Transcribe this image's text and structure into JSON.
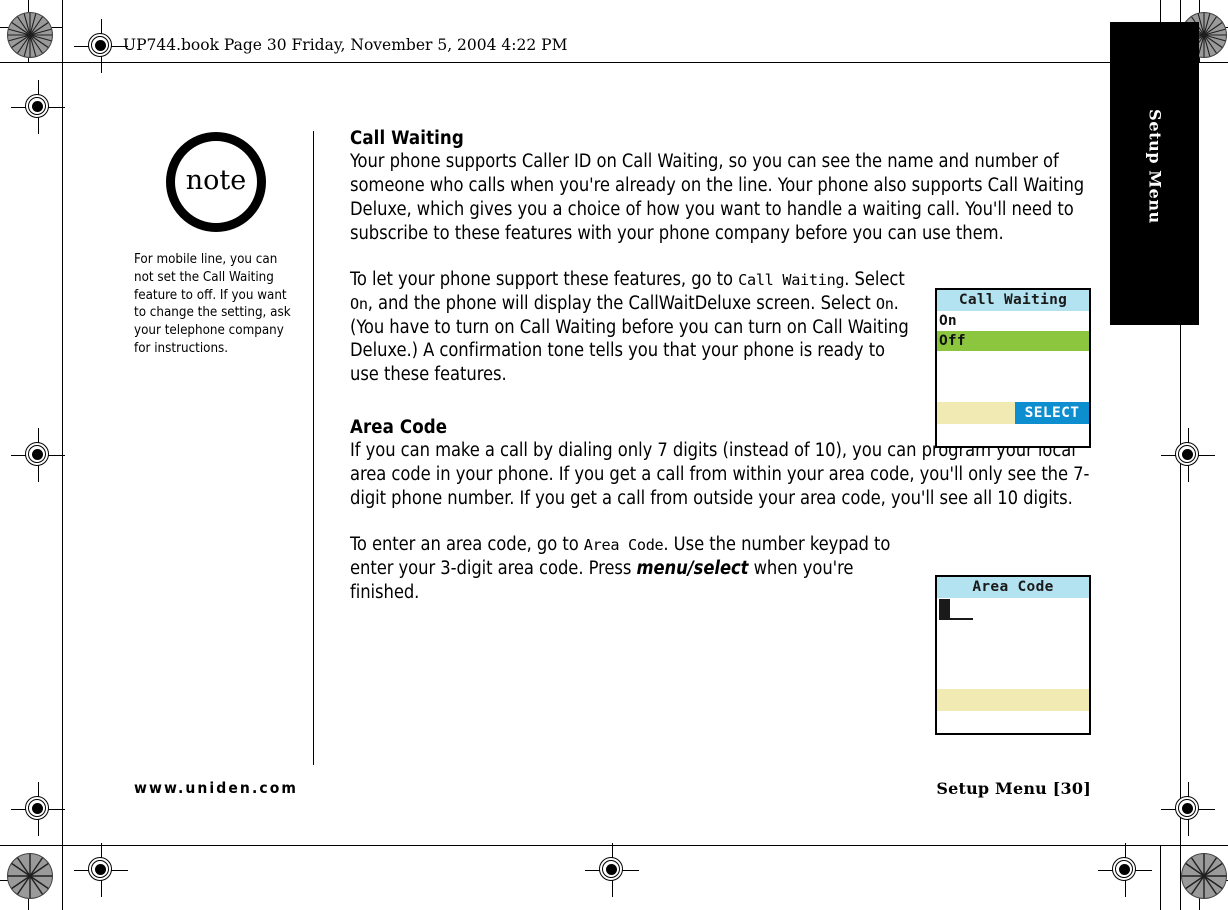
{
  "page": {
    "running_header": "UP744.book  Page 30  Friday, November 5, 2004  4:22 PM",
    "side_tab_label": "Setup Menu"
  },
  "note": {
    "badge_label": "note",
    "text": "For mobile line, you can not set the Call Waiting feature to off. If you want to change the setting, ask your telephone company for instructions."
  },
  "sections": {
    "call_waiting": {
      "heading": "Call Waiting",
      "intro": "Your phone supports Caller ID on Call Waiting, so you can see the name and number of someone who calls when you're already on the line. Your phone also supports Call Waiting Deluxe, which gives you a choice of how you want to handle a waiting call. You'll need to subscribe to these features with your phone company before you can use them.",
      "detail_1": "To let your phone support these features, go to ",
      "detail_term_1": "Call Waiting",
      "detail_2": ". Select ",
      "detail_term_2": "On",
      "detail_3": ", and the phone will display the CallWaitDeluxe screen. Select ",
      "detail_term_3": "On",
      "detail_4": ". (You have to turn on Call Waiting before you can turn on Call Waiting Deluxe.) A confirmation tone tells you that your phone is ready to use these features."
    },
    "area_code": {
      "heading": "Area Code",
      "intro": "If you can make a call by dialing only 7 digits (instead of 10), you can program your local area code in your phone. If you get a call from within your area code, you'll only see the 7-digit phone number. If you get a call from outside your area code, you'll see all 10 digits.",
      "detail_1": "To enter an area code, go to ",
      "detail_term_1": "Area Code",
      "detail_2": ". Use the number keypad to enter your 3-digit area code. Press ",
      "detail_key": "menu/select",
      "detail_3": " when you're finished."
    }
  },
  "lcd_call_waiting": {
    "title": "Call Waiting",
    "options": [
      {
        "label": "On",
        "selected": false
      },
      {
        "label": "Off",
        "selected": true
      }
    ],
    "softkey_label": "SELECT",
    "colors": {
      "title_bar": "#b3e2f0",
      "selected_row": "#8cc63e",
      "softkey_bg": "#0d8ecf",
      "softkey_text": "#ffffff",
      "bottom_bar": "#f2eab3"
    }
  },
  "lcd_area_code": {
    "title": "Area Code",
    "entry_value": "",
    "colors": {
      "title_bar": "#b3e2f0",
      "bottom_bar": "#f2eab3"
    }
  },
  "footer": {
    "url": "www.uniden.com",
    "page_mark": "Setup Menu [30]"
  }
}
